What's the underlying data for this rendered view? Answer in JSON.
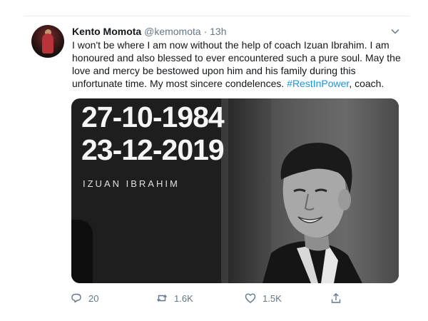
{
  "tweet": {
    "author_name": "Kento Momota",
    "author_handle": "@kemomota",
    "separator": "·",
    "time": "13h",
    "text_before_hashtag": "I won't be where I am now without the help of coach Izuan Ibrahim. I am honoured and also blessed to ever encountered such a pure soul. May the love and mercy be bestowed upon him and his family during this unfortunate time. My most sincere condelences. ",
    "hashtag": "#RestInPower",
    "text_after_hashtag": ", coach.",
    "hashtag_color": "#1b95e0"
  },
  "media": {
    "date_line_1": "27-10-1984",
    "date_line_2": "23-12-2019",
    "name": "IZUAN IBRAHIM"
  },
  "actions": {
    "reply_count": "20",
    "retweet_count": "1.6K",
    "like_count": "1.5K",
    "icons": [
      "reply-icon",
      "retweet-icon",
      "like-icon",
      "share-icon"
    ]
  },
  "menu": {
    "icon": "chevron-down-icon"
  }
}
